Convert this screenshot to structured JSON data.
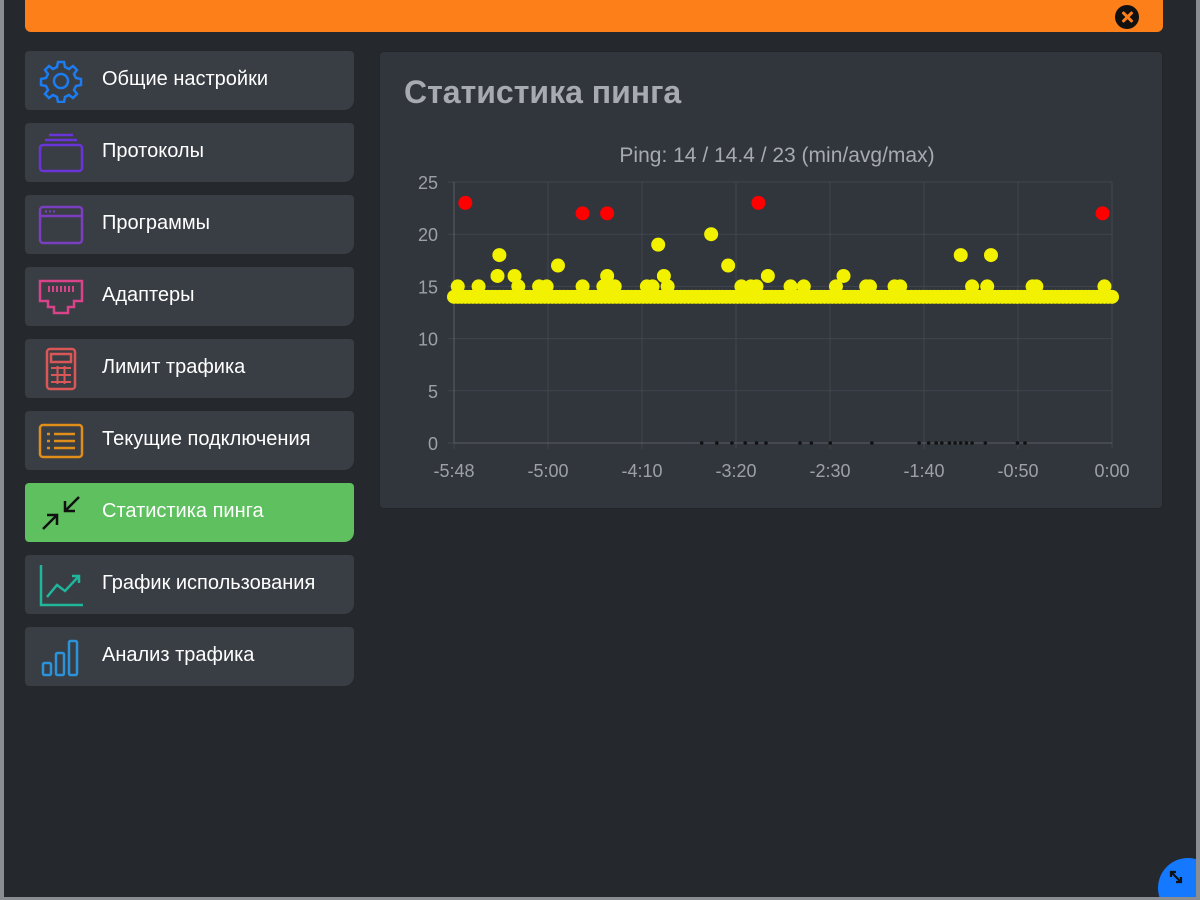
{
  "sidebar": {
    "items": [
      {
        "label": "Общие настройки",
        "icon": "gear-icon",
        "color": "#1c7cf2"
      },
      {
        "label": "Протоколы",
        "icon": "stack-icon",
        "color": "#6a35d8"
      },
      {
        "label": "Программы",
        "icon": "window-icon",
        "color": "#7a3fbf"
      },
      {
        "label": "Адаптеры",
        "icon": "ethernet-port-icon",
        "color": "#d8438a"
      },
      {
        "label": "Лимит трафика",
        "icon": "calculator-icon",
        "color": "#d95757"
      },
      {
        "label": "Текущие подключения",
        "icon": "list-icon",
        "color": "#e08d1a"
      },
      {
        "label": "Статистика пинга",
        "icon": "compress-arrows-icon",
        "color": "#ffffff",
        "active": true
      },
      {
        "label": "График использования",
        "icon": "line-chart-icon",
        "color": "#1fb69b"
      },
      {
        "label": "Анализ трафика",
        "icon": "bar-chart-icon",
        "color": "#2b93d9"
      }
    ]
  },
  "panel": {
    "title": "Статистика пинга"
  },
  "chart_data": {
    "type": "scatter",
    "title": "Ping: 14 / 14.4 / 23 (min/avg/max)",
    "xlabel": "",
    "ylabel": "",
    "xlim": [
      -348,
      0
    ],
    "ylim": [
      0,
      25
    ],
    "x_ticks": [
      "-5:48",
      "-5:00",
      "-4:10",
      "-3:20",
      "-2:30",
      "-1:40",
      "-0:50",
      "0:00"
    ],
    "y_ticks": [
      "0",
      "5",
      "10",
      "15",
      "20",
      "25"
    ],
    "grid": true,
    "colors": {
      "normal": "#f2f200",
      "high": "#ff0000",
      "lost": "#111111"
    },
    "baseline": {
      "x_from": -348,
      "x_to": 0,
      "step": 2,
      "y": 14
    },
    "series": [
      {
        "values": [
          [
            -346,
            15
          ],
          [
            -335,
            15
          ],
          [
            -325,
            16
          ],
          [
            -324,
            18
          ],
          [
            -316,
            16
          ],
          [
            -314,
            15
          ],
          [
            -303,
            15
          ],
          [
            -299,
            15
          ],
          [
            -293,
            17
          ],
          [
            -280,
            15
          ],
          [
            -269,
            15
          ],
          [
            -267,
            16
          ],
          [
            -263,
            15
          ],
          [
            -246,
            15
          ],
          [
            -243,
            15
          ],
          [
            -240,
            19
          ],
          [
            -237,
            16
          ],
          [
            -235,
            15
          ],
          [
            -212,
            20
          ],
          [
            -203,
            17
          ],
          [
            -196,
            15
          ],
          [
            -191,
            15
          ],
          [
            -188,
            15
          ],
          [
            -182,
            16
          ],
          [
            -170,
            15
          ],
          [
            -163,
            15
          ],
          [
            -146,
            15
          ],
          [
            -142,
            16
          ],
          [
            -130,
            15
          ],
          [
            -128,
            15
          ],
          [
            -115,
            15
          ],
          [
            -112,
            15
          ],
          [
            -80,
            18
          ],
          [
            -74,
            15
          ],
          [
            -66,
            15
          ],
          [
            -64,
            18
          ],
          [
            -42,
            15
          ],
          [
            -40,
            15
          ],
          [
            -4,
            15
          ]
        ]
      },
      {
        "values": [
          [
            -342,
            23
          ],
          [
            -280,
            22
          ],
          [
            -267,
            22
          ],
          [
            -187,
            23
          ],
          [
            -5,
            22
          ]
        ]
      },
      {
        "values": [
          [
            -217,
            0
          ],
          [
            -209,
            0
          ],
          [
            -201,
            0
          ],
          [
            -194,
            0
          ],
          [
            -188,
            0
          ],
          [
            -183,
            0
          ],
          [
            -165,
            0
          ],
          [
            -159,
            0
          ],
          [
            -149,
            0
          ],
          [
            -127,
            0
          ],
          [
            -102,
            0
          ],
          [
            -97,
            0
          ],
          [
            -93,
            0
          ],
          [
            -90,
            0
          ],
          [
            -86,
            0
          ],
          [
            -83,
            0
          ],
          [
            -80,
            0
          ],
          [
            -77,
            0
          ],
          [
            -74,
            0
          ],
          [
            -67,
            0
          ],
          [
            -50,
            0
          ],
          [
            -46,
            0
          ]
        ]
      }
    ]
  }
}
